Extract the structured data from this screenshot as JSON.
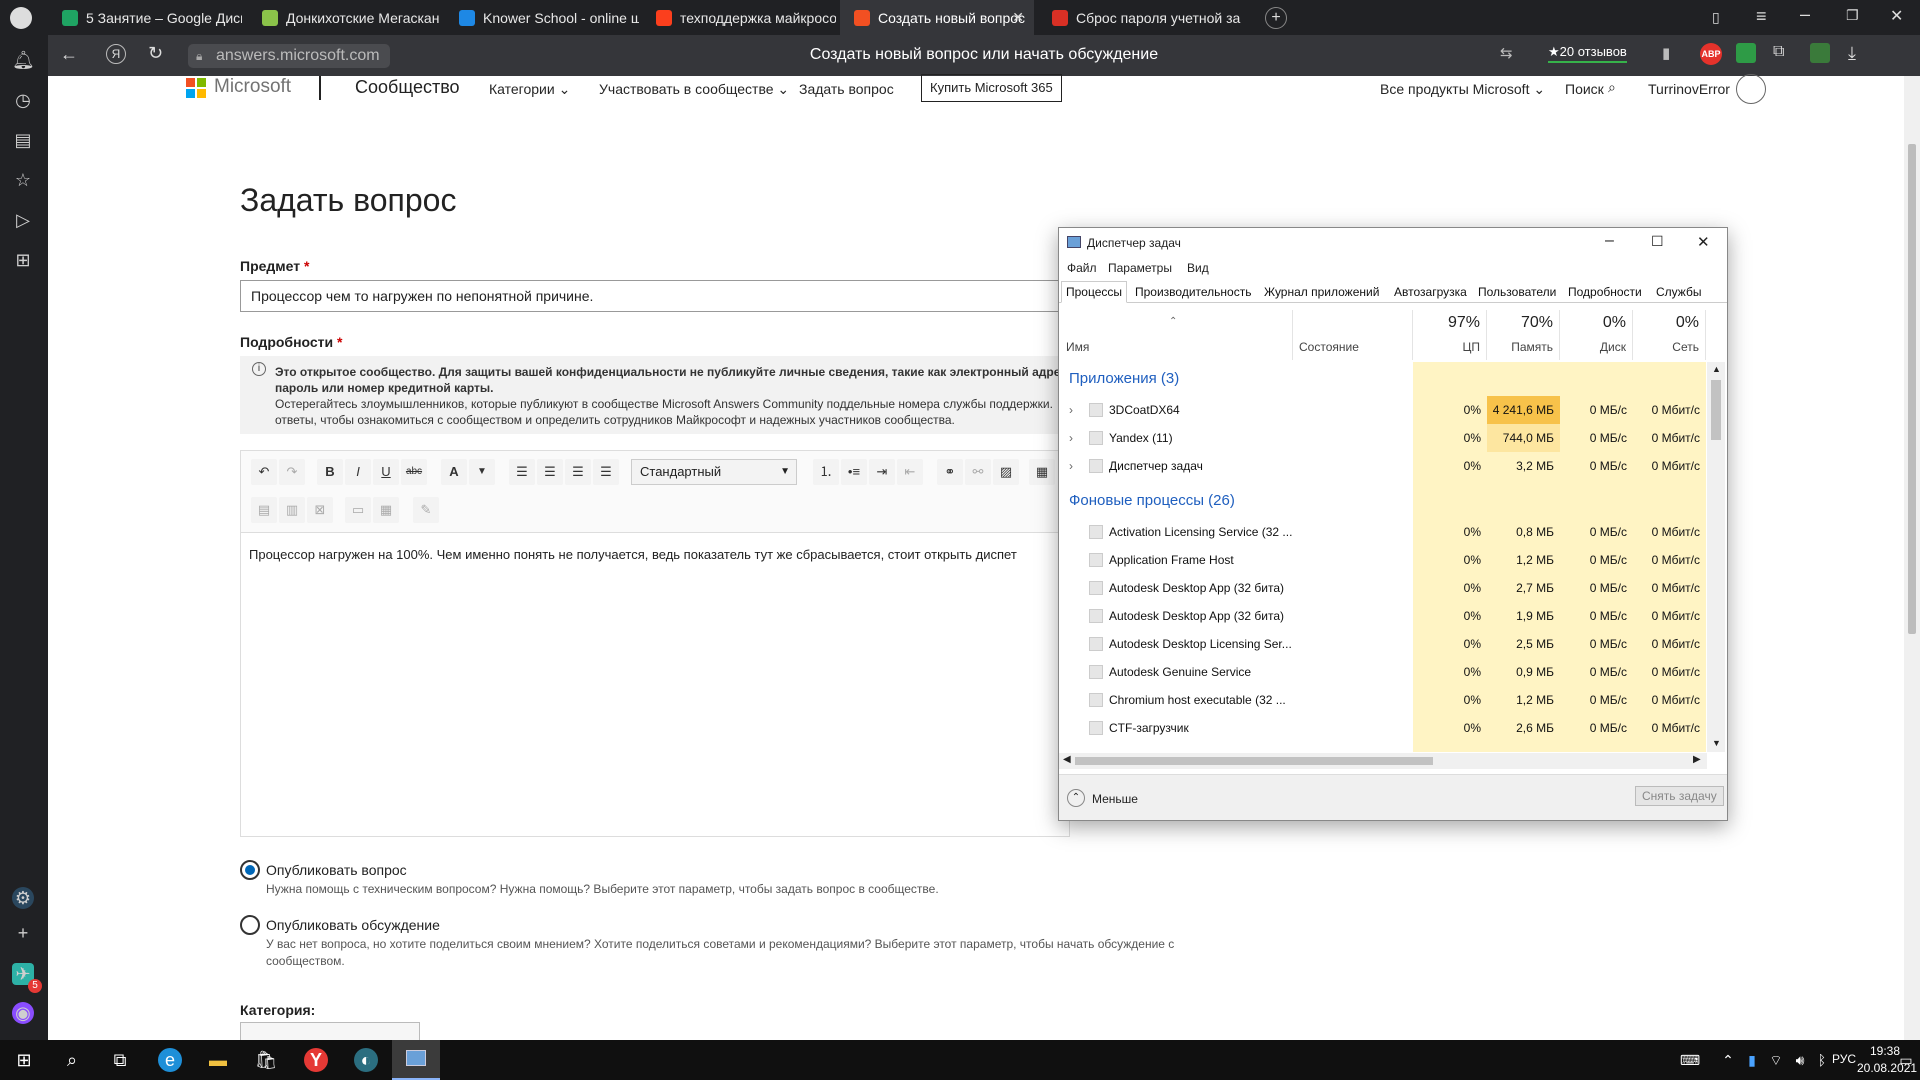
{
  "browser": {
    "tabs": [
      {
        "label": "5 Занятие – Google Диск",
        "color": "#1fa463"
      },
      {
        "label": "Донкихотские Мегаскан",
        "color": "#8bc34a"
      },
      {
        "label": "Knower School - online ш",
        "color": "#1e88e5"
      },
      {
        "label": "техподдержка майкрософ",
        "color": "#fc3f1d"
      },
      {
        "label": "Создать новый вопрос",
        "color": "#f25022"
      },
      {
        "label": "Сброс пароля учетной за",
        "color": "#d93025"
      }
    ],
    "url": "answers.microsoft.com",
    "page_title": "Создать новый вопрос или начать обсуждение",
    "reviews": "★20 отзывов",
    "abp": "ABP"
  },
  "header": {
    "logo": "Microsoft",
    "community": "Сообщество",
    "nav": [
      "Категории ⌄",
      "Участвовать в сообществе ⌄",
      "Задать вопрос"
    ],
    "buy": "Купить Microsoft 365",
    "all_products": "Все продукты Microsoft ⌄",
    "search": "Поиск",
    "user": "TurrinovError"
  },
  "form": {
    "heading": "Задать вопрос",
    "subject_label": "Предмет",
    "subject_value": "Процессор чем то нагружен по непонятной причине.",
    "details_label": "Подробности",
    "notice_line1": "Это открытое сообщество. Для защиты вашей конфиденциальности не публикуйте личные сведения, такие как электронный адрес, номе",
    "notice_line2": "пароль или номер кредитной карты.",
    "notice_line3": "Остерегайтесь злоумышленников, которые публикуют в сообществе Microsoft Answers Community поддельные номера службы поддержки.",
    "notice_line4": "ответы, чтобы ознакомиться с сообществом и определить сотрудников Майкрософт и надежных участников сообщества.",
    "style_select": "Стандартный",
    "body_text": "Процессор нагружен на 100%. Чем именно понять не получается, ведь показатель тут же сбрасывается, стоит открыть диспет",
    "option1_label": "Опубликовать вопрос",
    "option1_desc": "Нужна помощь с техническим вопросом? Нужна помощь? Выберите этот параметр, чтобы задать вопрос в сообществе.",
    "option2_label": "Опубликовать обсуждение",
    "option2_desc_line1": "У вас нет вопроса, но хотите поделиться своим мнением? Хотите поделиться советами и рекомендациями? Выберите этот параметр, чтобы начать обсуждение с",
    "option2_desc_line2": "сообществом.",
    "category_label": "Категория:"
  },
  "taskmgr": {
    "title": "Диспетчер задач",
    "menu": [
      "Файл",
      "Параметры",
      "Вид"
    ],
    "tabs": [
      "Процессы",
      "Производительность",
      "Журнал приложений",
      "Автозагрузка",
      "Пользователи",
      "Подробности",
      "Службы"
    ],
    "columns": {
      "name": "Имя",
      "status": "Состояние",
      "cpu_pct": "97%",
      "cpu": "ЦП",
      "mem_pct": "70%",
      "mem": "Память",
      "disk_pct": "0%",
      "disk": "Диск",
      "net_pct": "0%",
      "net": "Сеть"
    },
    "group_apps": "Приложения (3)",
    "group_bg": "Фоновые процессы (26)",
    "apps": [
      {
        "name": "3DCoatDX64",
        "cpu": "0%",
        "mem": "4 241,6 МБ",
        "disk": "0 МБ/с",
        "net": "0 Мбит/с"
      },
      {
        "name": "Yandex (11)",
        "cpu": "0%",
        "mem": "744,0 МБ",
        "disk": "0 МБ/с",
        "net": "0 Мбит/с"
      },
      {
        "name": "Диспетчер задач",
        "cpu": "0%",
        "mem": "3,2 МБ",
        "disk": "0 МБ/с",
        "net": "0 Мбит/с"
      }
    ],
    "background": [
      {
        "name": "Activation Licensing Service (32 ...",
        "cpu": "0%",
        "mem": "0,8 МБ",
        "disk": "0 МБ/с",
        "net": "0 Мбит/с"
      },
      {
        "name": "Application Frame Host",
        "cpu": "0%",
        "mem": "1,2 МБ",
        "disk": "0 МБ/с",
        "net": "0 Мбит/с"
      },
      {
        "name": "Autodesk Desktop App (32 бита)",
        "cpu": "0%",
        "mem": "2,7 МБ",
        "disk": "0 МБ/с",
        "net": "0 Мбит/с"
      },
      {
        "name": "Autodesk Desktop App (32 бита)",
        "cpu": "0%",
        "mem": "1,9 МБ",
        "disk": "0 МБ/с",
        "net": "0 Мбит/с"
      },
      {
        "name": "Autodesk Desktop Licensing Ser...",
        "cpu": "0%",
        "mem": "2,5 МБ",
        "disk": "0 МБ/с",
        "net": "0 Мбит/с"
      },
      {
        "name": "Autodesk Genuine Service",
        "cpu": "0%",
        "mem": "0,9 МБ",
        "disk": "0 МБ/с",
        "net": "0 Мбит/с"
      },
      {
        "name": "Chromium host executable (32 ...",
        "cpu": "0%",
        "mem": "1,2 МБ",
        "disk": "0 МБ/с",
        "net": "0 Мбит/с"
      },
      {
        "name": "CTF-загрузчик",
        "cpu": "0%",
        "mem": "2,6 МБ",
        "disk": "0 МБ/с",
        "net": "0 Мбит/с"
      }
    ],
    "less": "Меньше",
    "end_task": "Снять задачу"
  },
  "taskbar": {
    "lang": "РУС",
    "time": "19:38",
    "date": "20.08.2021",
    "badge": "5"
  }
}
